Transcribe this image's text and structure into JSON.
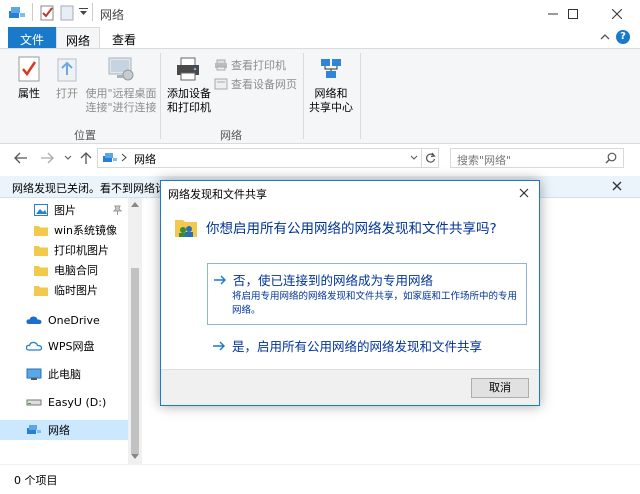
{
  "window": {
    "title": "网络"
  },
  "tabs": {
    "file": "文件",
    "network": "网络",
    "view": "查看"
  },
  "ribbon": {
    "properties": "属性",
    "open": "打开",
    "remote_line1": "使用\"远程桌面",
    "remote_line2": "连接\"进行连接",
    "location_group": "位置",
    "add_device_line1": "添加设备",
    "add_device_line2": "和打印机",
    "view_printers": "查看打印机",
    "view_device_page": "查看设备网页",
    "network_center_line1": "网络和",
    "network_center_line2": "共享中心",
    "network_group": "网络"
  },
  "address": {
    "path": "网络",
    "search_placeholder": "搜索\"网络\""
  },
  "infobar": {
    "text": "网络发现已关闭。看不到网络计"
  },
  "sidebar": {
    "items": [
      {
        "label": "图片",
        "icon": "pictures-icon"
      },
      {
        "label": "win系统镜像",
        "icon": "folder-icon"
      },
      {
        "label": "打印机图片",
        "icon": "folder-icon"
      },
      {
        "label": "电脑合同",
        "icon": "folder-icon"
      },
      {
        "label": "临时图片",
        "icon": "folder-icon"
      },
      {
        "label": "OneDrive",
        "icon": "onedrive-icon"
      },
      {
        "label": "WPS网盘",
        "icon": "wps-cloud-icon"
      },
      {
        "label": "此电脑",
        "icon": "this-pc-icon"
      },
      {
        "label": "EasyU (D:)",
        "icon": "drive-icon"
      },
      {
        "label": "网络",
        "icon": "network-icon"
      }
    ]
  },
  "status": {
    "items_count": "0 个项目"
  },
  "dialog": {
    "title": "网络发现和文件共享",
    "question": "你想启用所有公用网络的网络发现和文件共享吗?",
    "option_no_title": "否，使已连接到的网络成为专用网络",
    "option_no_desc": "将启用专用网络的网络发现和文件共享，如家庭和工作场所中的专用网络。",
    "option_yes_title": "是，启用所有公用网络的网络发现和文件共享",
    "cancel": "取消"
  },
  "colors": {
    "accent": "#1979ca",
    "link": "#003399",
    "selected": "#cce8ff",
    "infobar": "#ebf4fb"
  }
}
